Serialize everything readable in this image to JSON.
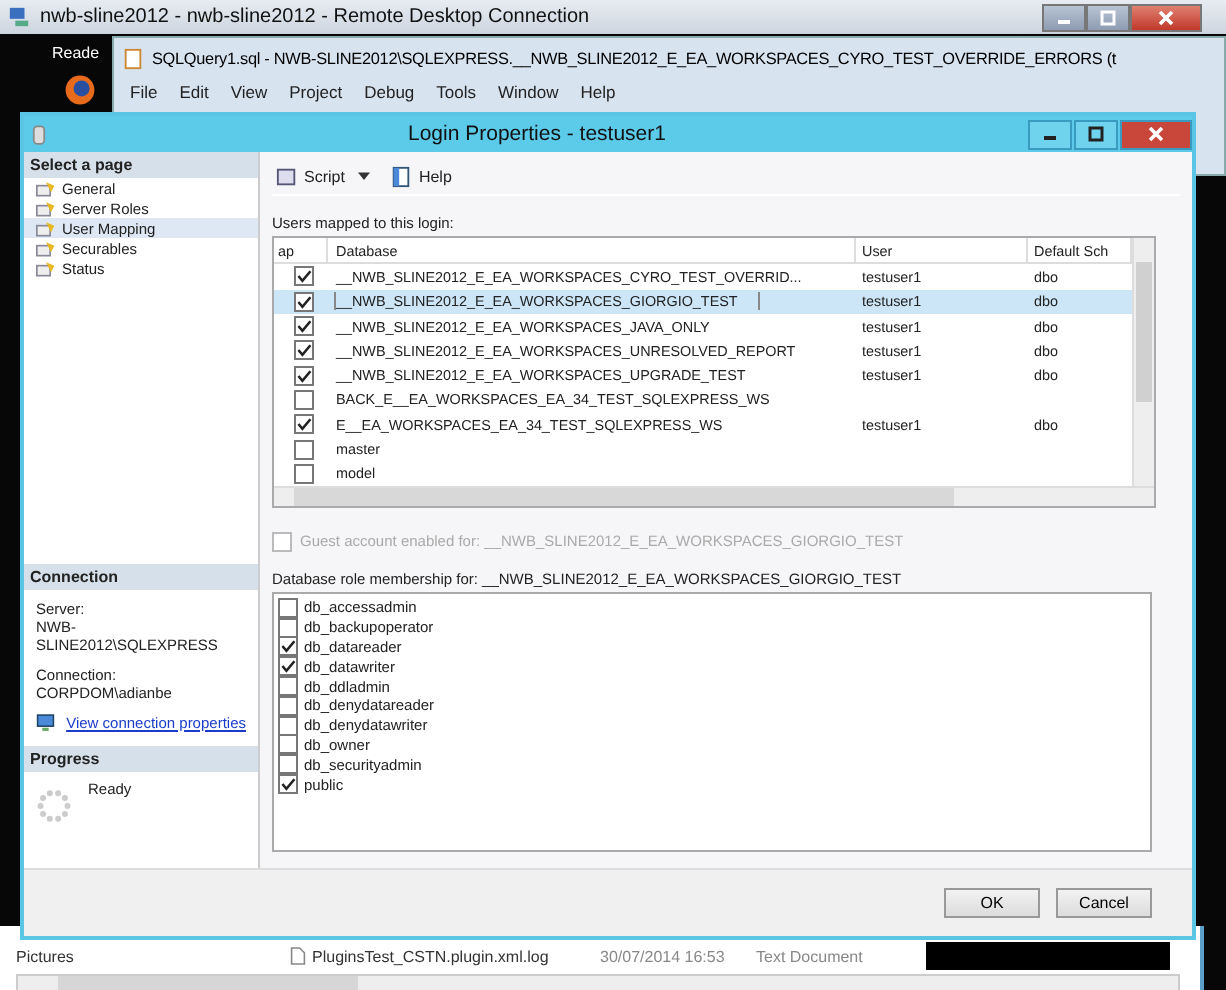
{
  "remote_window": {
    "title": "nwb-sline2012 - nwb-sline2012 - Remote Desktop Connection"
  },
  "desktop": {
    "label": "Reade"
  },
  "ssms_window": {
    "title": "SQLQuery1.sql - NWB-SLINE2012\\SQLEXPRESS.__NWB_SLINE2012_E_EA_WORKSPACES_CYRO_TEST_OVERRIDE_ERRORS (t",
    "menu": [
      "File",
      "Edit",
      "View",
      "Project",
      "Debug",
      "Tools",
      "Window",
      "Help"
    ]
  },
  "dialog": {
    "title": "Login Properties - testuser1",
    "sidebar": {
      "header": "Select a page",
      "items": [
        {
          "label": "General",
          "selected": false
        },
        {
          "label": "Server Roles",
          "selected": false
        },
        {
          "label": "User Mapping",
          "selected": true
        },
        {
          "label": "Securables",
          "selected": false
        },
        {
          "label": "Status",
          "selected": false
        }
      ]
    },
    "connection": {
      "header": "Connection",
      "server_label": "Server:",
      "server": "NWB-SLINE2012\\SQLEXPRESS",
      "connection_label": "Connection:",
      "connection": "CORPDOM\\adianbe",
      "link": "View connection properties"
    },
    "progress": {
      "header": "Progress",
      "status": "Ready"
    },
    "toolbar": {
      "script": "Script",
      "help": "Help"
    },
    "users": {
      "label": "Users mapped to this login:",
      "columns": [
        "ap",
        "Database",
        "User",
        "Default Sch"
      ],
      "rows": [
        {
          "map": true,
          "database": "__NWB_SLINE2012_E_EA_WORKSPACES_CYRO_TEST_OVERRID...",
          "user": "testuser1",
          "schema": "dbo",
          "selected": false
        },
        {
          "map": true,
          "database": "__NWB_SLINE2012_E_EA_WORKSPACES_GIORGIO_TEST",
          "user": "testuser1",
          "schema": "dbo",
          "selected": true
        },
        {
          "map": true,
          "database": "__NWB_SLINE2012_E_EA_WORKSPACES_JAVA_ONLY",
          "user": "testuser1",
          "schema": "dbo",
          "selected": false
        },
        {
          "map": true,
          "database": "__NWB_SLINE2012_E_EA_WORKSPACES_UNRESOLVED_REPORT",
          "user": "testuser1",
          "schema": "dbo",
          "selected": false
        },
        {
          "map": true,
          "database": "__NWB_SLINE2012_E_EA_WORKSPACES_UPGRADE_TEST",
          "user": "testuser1",
          "schema": "dbo",
          "selected": false
        },
        {
          "map": false,
          "database": "BACK_E__EA_WORKSPACES_EA_34_TEST_SQLEXPRESS_WS",
          "user": "",
          "schema": "",
          "selected": false
        },
        {
          "map": true,
          "database": "E__EA_WORKSPACES_EA_34_TEST_SQLEXPRESS_WS",
          "user": "testuser1",
          "schema": "dbo",
          "selected": false
        },
        {
          "map": false,
          "database": "master",
          "user": "",
          "schema": "",
          "selected": false
        },
        {
          "map": false,
          "database": "model",
          "user": "",
          "schema": "",
          "selected": false
        }
      ]
    },
    "guest": {
      "label": "Guest account enabled for: __NWB_SLINE2012_E_EA_WORKSPACES_GIORGIO_TEST",
      "checked": false,
      "disabled": true
    },
    "roles": {
      "label": "Database role membership for: __NWB_SLINE2012_E_EA_WORKSPACES_GIORGIO_TEST",
      "items": [
        {
          "label": "db_accessadmin",
          "checked": false
        },
        {
          "label": "db_backupoperator",
          "checked": false
        },
        {
          "label": "db_datareader",
          "checked": true
        },
        {
          "label": "db_datawriter",
          "checked": true
        },
        {
          "label": "db_ddladmin",
          "checked": false
        },
        {
          "label": "db_denydatareader",
          "checked": false
        },
        {
          "label": "db_denydatawriter",
          "checked": false
        },
        {
          "label": "db_owner",
          "checked": false
        },
        {
          "label": "db_securityadmin",
          "checked": false
        },
        {
          "label": "public",
          "checked": true
        }
      ]
    },
    "buttons": [
      "OK",
      "Cancel"
    ]
  },
  "explorer": {
    "folder": "Pictures",
    "file": {
      "name": "PluginsTest_CSTN.plugin.xml.log",
      "date": "30/07/2014 16:53",
      "type": "Text Document"
    }
  }
}
